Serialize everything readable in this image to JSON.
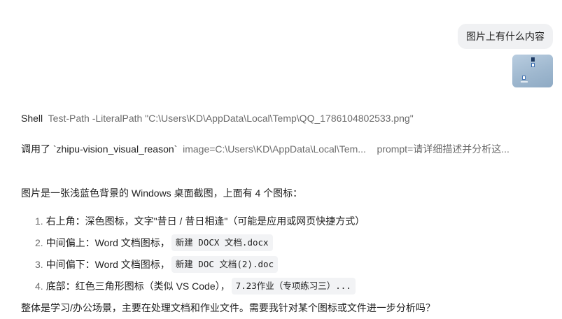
{
  "user_message": {
    "text": "图片上有什么内容"
  },
  "tool_calls": {
    "shell": {
      "name": "Shell",
      "args": "Test-Path -LiteralPath \"C:\\Users\\KD\\AppData\\Local\\Temp\\QQ_1786104802533.png\""
    },
    "vision": {
      "name": "调用了 `zhipu-vision_visual_reason`",
      "arg_image": "image=C:\\Users\\KD\\AppData\\Local\\Tem...",
      "arg_prompt": "prompt=请详细描述并分析这..."
    }
  },
  "answer": {
    "intro": "图片是一张浅蓝色背景的 Windows 桌面截图，上面有 4 个图标：",
    "items": [
      {
        "num": "1.",
        "text": "右上角：深色图标，文字\"昔日 / 昔日相逢\"（可能是应用或网页快捷方式）",
        "code": ""
      },
      {
        "num": "2.",
        "text": "中间偏上：Word 文档图标，",
        "code": "新建 DOCX 文档.docx"
      },
      {
        "num": "3.",
        "text": "中间偏下：Word 文档图标，",
        "code": "新建 DOC 文档(2).doc"
      },
      {
        "num": "4.",
        "text": "底部：红色三角形图标（类似 VS Code），",
        "code": "7.23作业（专项练习三）..."
      }
    ],
    "summary": "整体是学习/办公场景，主要在处理文档和作业文件。需要我针对某个图标或文件进一步分析吗？"
  },
  "colors": {
    "user_bubble_bg": "#f0f1f3",
    "code_bg": "#f2f3f5",
    "muted_text": "#6b6b6b"
  }
}
